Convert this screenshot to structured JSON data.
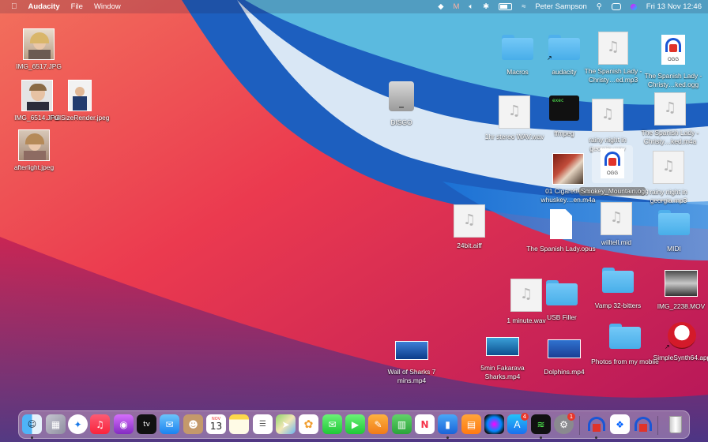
{
  "menubar": {
    "app_name": "Audacity",
    "menus": [
      "File",
      "Window"
    ],
    "user": "Peter Sampson",
    "datetime": "Fri 13 Nov  12:46",
    "icons": [
      "apple-icon",
      "dropbox-icon",
      "malwarebytes-icon",
      "volume-icon",
      "bluetooth-icon",
      "battery-icon",
      "wifi-icon",
      "search-icon",
      "control-center-icon",
      "siri-icon"
    ]
  },
  "desktop": {
    "left_photos": [
      {
        "label": "IMG_6517.JPG"
      },
      {
        "label": "IMG_6514.JPG"
      },
      {
        "label": "FullSizeRender.jpeg"
      },
      {
        "label": "afterlight.jpeg"
      }
    ],
    "disk": {
      "label": "DISGO"
    },
    "items": {
      "macros": "Macros",
      "audacity": "audacity",
      "spanish_mp3": "The Spanish Lady - Christy…ed.mp3",
      "spanish_ogg": "The Spanish Lady - Christy…ked.ogg",
      "stereo": "1hr stereo WAV.wav",
      "ffmpeg": "ffmpeg",
      "rainy_wav": "rainy night in georgia.wav",
      "spanish_m4a": "The Spanish Lady - Christy…ked.m4a",
      "cigarettes": "01 Cigarettes & whuskey…en.m4a",
      "smokey": "Smokey_Mountain.ogg",
      "rainy_mp3": "rainy night in georgia.mp3",
      "aiff": "24bit.aiff",
      "spanish_opus": "The Spanish Lady.opus",
      "willtell": "willtell.mid",
      "midi": "MIDI",
      "one_minute": "1 minute.wav",
      "usb_filler": "USB Filler",
      "vamp": "Vamp 32-bitters",
      "img2238": "IMG_2238.MOV",
      "wall_sharks": "Wall of Sharks 7 mins.mp4",
      "fakarava": "5min Fakarava Sharks.mp4",
      "dolphins": "Dolphins.mp4",
      "photos_mobile": "Photos from my mobile",
      "simplesynth": "SimpleSynth64.app"
    },
    "exec_text": "exec"
  },
  "dock": {
    "calendar": {
      "month": "NOV",
      "day": "13"
    },
    "tv_label": "tv",
    "appstore_badge": "4",
    "settings_badge": "1",
    "apps": [
      "finder",
      "launchpad",
      "safari",
      "music",
      "podcasts",
      "apple-tv",
      "mail",
      "contacts",
      "calendar",
      "notes",
      "reminders",
      "maps",
      "photos",
      "messages",
      "facetime",
      "pages",
      "numbers",
      "news",
      "keynote",
      "books",
      "siri",
      "app-store",
      "activity-monitor",
      "system-preferences",
      "audacity",
      "dropbox",
      "audacity-alt",
      "trash"
    ]
  },
  "colors": {
    "folder": "#5dbcf3",
    "wallpaper_red": "#e8284a",
    "wallpaper_blue": "#3a7fd0"
  }
}
